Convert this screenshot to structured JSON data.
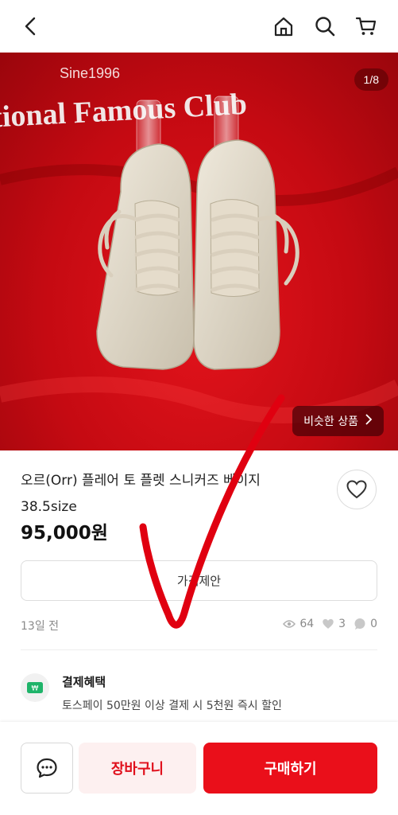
{
  "header": {
    "icons": [
      "back-icon",
      "home-icon",
      "search-icon",
      "cart-icon"
    ]
  },
  "gallery": {
    "counter": "1/8",
    "similar_label": "비슷한 상품",
    "banner_text_top": "Sine1996",
    "banner_text_main": "tional Famous Club"
  },
  "product": {
    "title_line1": "오르(Orr) 플레어 토 플렛 스니커즈 베이지",
    "title_line2": "38.5size",
    "price": "95,000원",
    "offer_label": "가격제안",
    "posted": "13일 전",
    "views": "64",
    "likes": "3",
    "chats": "0"
  },
  "benefit": {
    "title": "결제혜택",
    "description": "토스페이 50만원 이상 결제 시 5천원 즉시 할인"
  },
  "actions": {
    "cart_label": "장바구니",
    "buy_label": "구매하기"
  },
  "colors": {
    "accent": "#ea0f1a",
    "cart_bg": "#fdf0f0",
    "benefit_icon": "#1fb46a"
  }
}
